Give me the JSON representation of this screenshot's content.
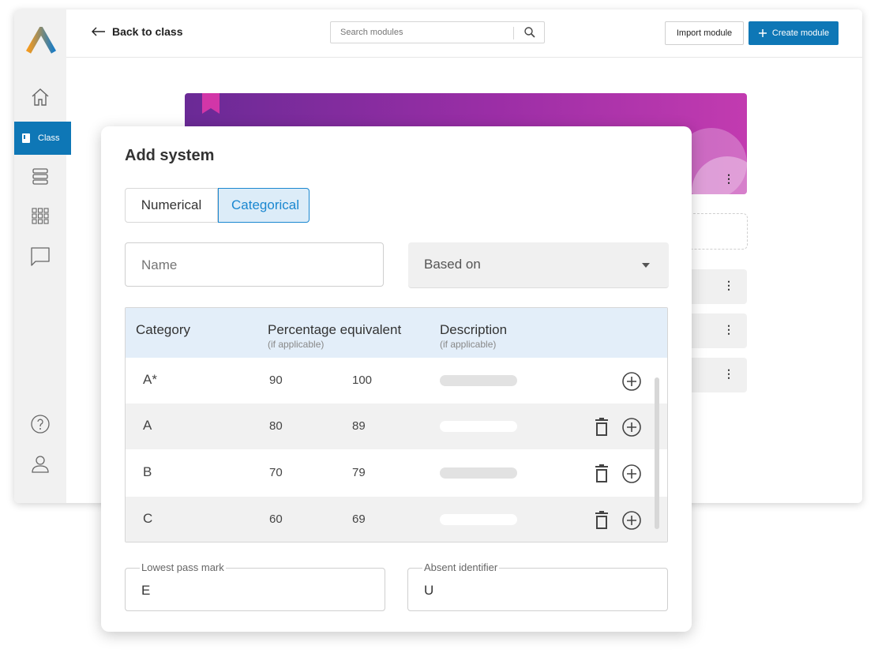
{
  "topbar": {
    "back_label": "Back to class",
    "search_placeholder": "Search modules",
    "import_label": "Import module",
    "create_label": "Create module"
  },
  "sidebar": {
    "items": [
      {
        "icon": "home-icon"
      },
      {
        "label": "Class",
        "icon": "book-icon",
        "active": true
      },
      {
        "icon": "stack-icon"
      },
      {
        "icon": "grid-icon"
      },
      {
        "icon": "chat-icon"
      }
    ],
    "bottom": [
      {
        "icon": "help-icon"
      },
      {
        "icon": "user-icon"
      }
    ]
  },
  "colors": {
    "accent": "#0e77b6",
    "banner_start": "#6a2a96",
    "banner_end": "#c23bb0",
    "selected_tab": "#1a87d0"
  },
  "modal": {
    "title": "Add system",
    "tabs": [
      {
        "label": "Numerical",
        "selected": false
      },
      {
        "label": "Categorical",
        "selected": true
      }
    ],
    "name_placeholder": "Name",
    "based_on_label": "Based on",
    "table": {
      "headers": [
        {
          "label": "Category",
          "sub": ""
        },
        {
          "label": "Percentage equivalent",
          "sub": "(if applicable)"
        },
        {
          "label": "Description",
          "sub": "(if applicable)"
        }
      ],
      "rows": [
        {
          "category": "A*",
          "min": "90",
          "max": "100",
          "deletable": false
        },
        {
          "category": "A",
          "min": "80",
          "max": "89",
          "deletable": true
        },
        {
          "category": "B",
          "min": "70",
          "max": "79",
          "deletable": true
        },
        {
          "category": "C",
          "min": "60",
          "max": "69",
          "deletable": true
        }
      ]
    },
    "lowest_pass_label": "Lowest pass mark",
    "lowest_pass_value": "E",
    "absent_label": "Absent identifier",
    "absent_value": "U"
  }
}
